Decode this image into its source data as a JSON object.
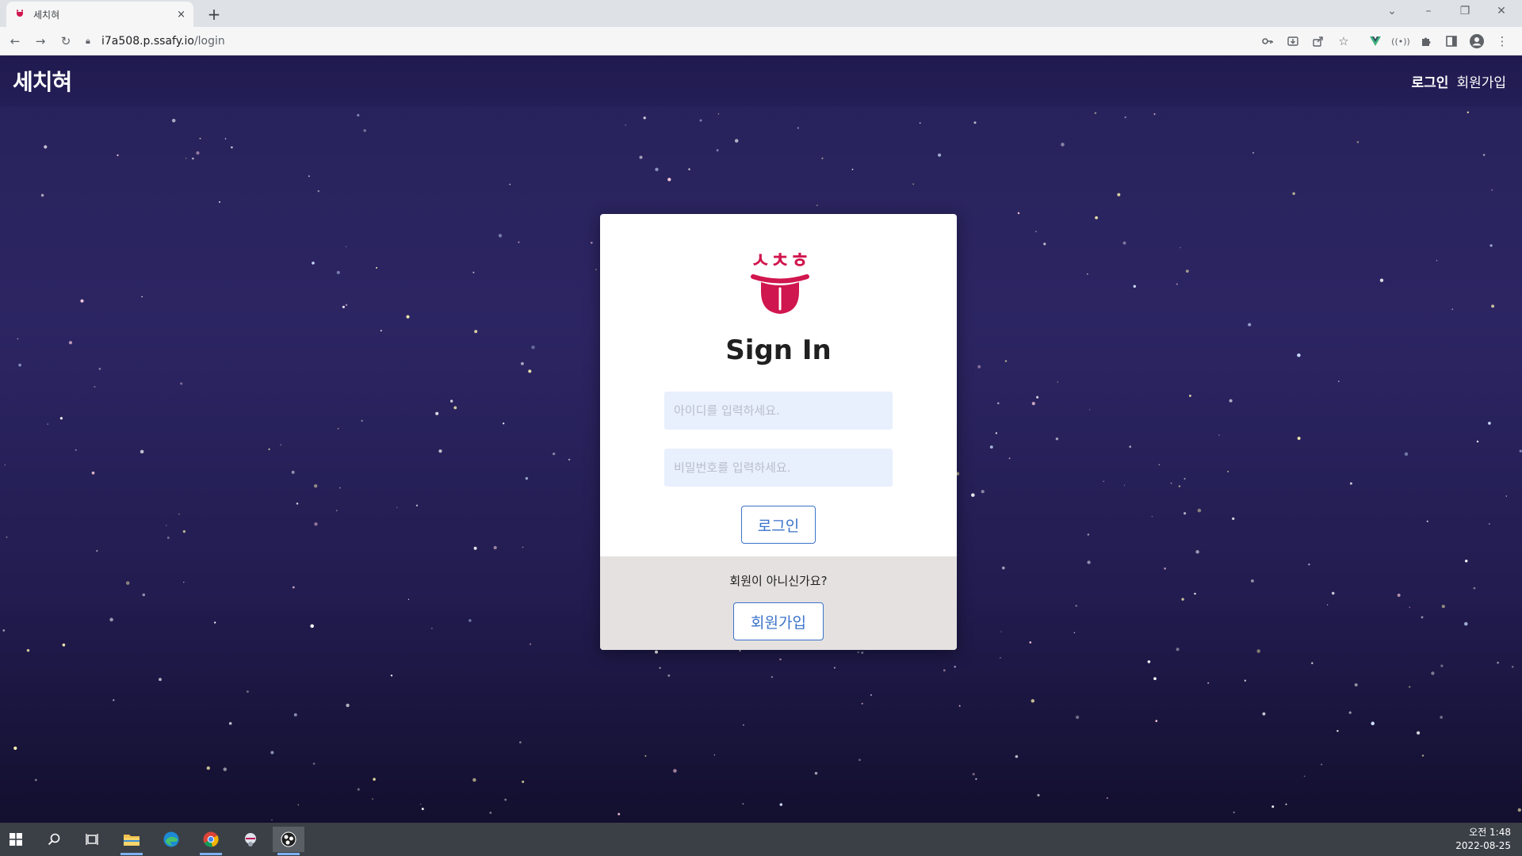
{
  "browser": {
    "tab_title": "세치혀",
    "tab_close": "×",
    "new_tab": "+",
    "url_host": "i7a508.p.ssafy.io",
    "url_path": "/login"
  },
  "navbar": {
    "brand": "세치혀",
    "login_link": "로그인",
    "signup_link": "회원가입"
  },
  "login": {
    "logo_text": "ㅅㅊㅎ",
    "title": "Sign In",
    "id_placeholder": "아이디를 입력하세요.",
    "pw_placeholder": "비밀번호를 입력하세요.",
    "login_button": "로그인",
    "signup_prompt": "회원이 아니신가요?",
    "signup_button": "회원가입"
  },
  "colors": {
    "accent": "#3b73c9",
    "logo": "#d0164e",
    "sky_top": "#27225a",
    "sky_bottom": "#130f2e"
  },
  "taskbar": {
    "time": "오전 1:48",
    "date": "2022-08-25"
  }
}
